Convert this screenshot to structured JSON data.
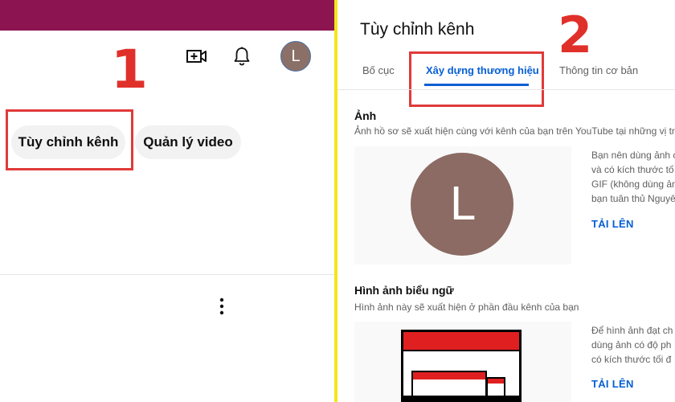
{
  "left": {
    "topbar_color": "#8c1450",
    "icons": {
      "create": "video-plus-icon",
      "notifications": "bell-icon",
      "more": "more-vertical-icon"
    },
    "avatar_letter": "L",
    "avatar_color": "#8b7068",
    "step_number": "1",
    "customize_button_label": "Tùy chỉnh kênh",
    "manage_button_label": "Quản lý video"
  },
  "right": {
    "title": "Tùy chỉnh kênh",
    "step_number": "2",
    "tabs": [
      {
        "label": "Bố cục"
      },
      {
        "label": "Xây dựng thương hiệu",
        "active": true
      },
      {
        "label": "Thông tin cơ bản"
      }
    ],
    "photo": {
      "title": "Ảnh",
      "desc": "Ảnh hồ sơ sẽ xuất hiện cùng với kênh của bạn trên YouTube tại những vị trí",
      "avatar_letter": "L",
      "avatar_color": "#8b6b63",
      "side_lines": [
        "Bạn nên dùng ảnh c",
        "và có kích thước tố",
        "GIF (không dùng ản",
        "bạn tuân thủ Nguyê"
      ],
      "upload_label": "TẢI LÊN"
    },
    "banner": {
      "title": "Hình ảnh biểu ngữ",
      "desc": "Hình ảnh này sẽ xuất hiện ở phần đầu kênh của bạn",
      "side_lines": [
        "Để hình ảnh đạt ch",
        "dùng ảnh có độ ph",
        "có kích thước tối đ"
      ],
      "upload_label": "TẢI LÊN"
    }
  }
}
